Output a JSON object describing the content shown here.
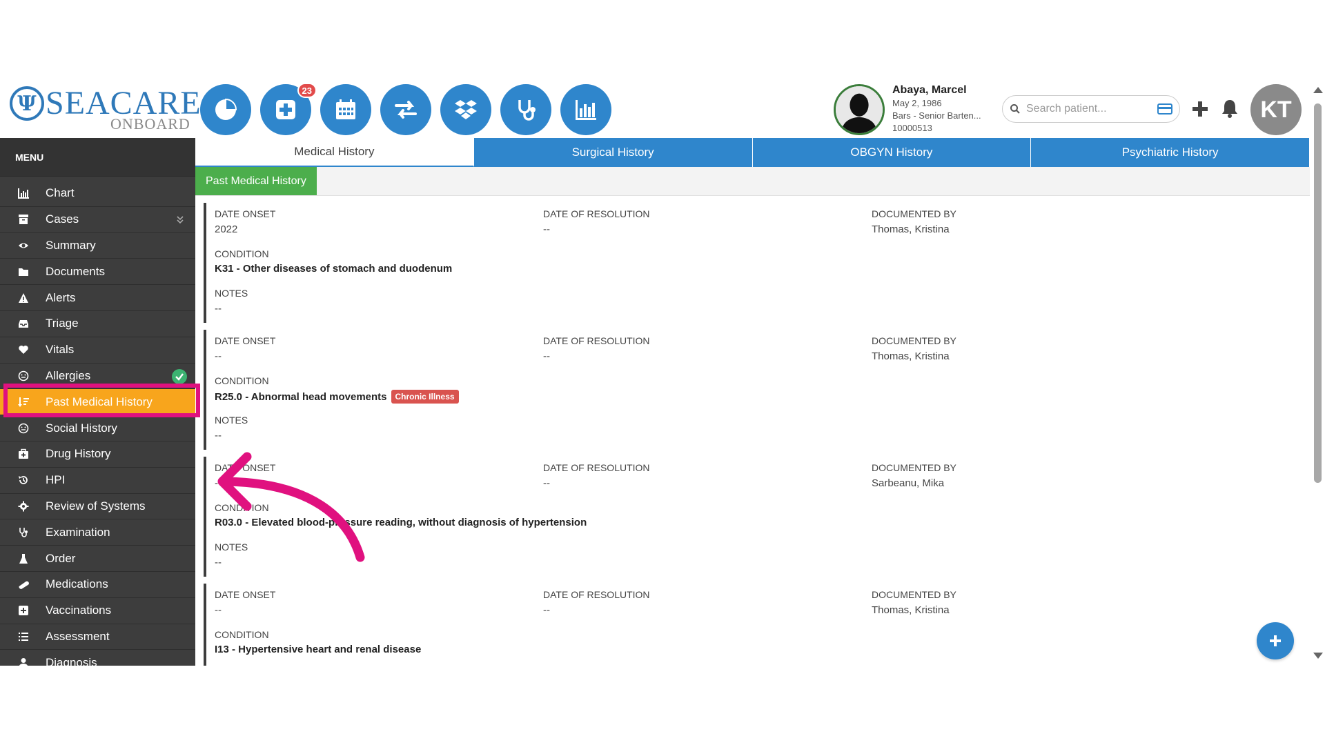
{
  "logo": {
    "name": "SEACARE",
    "sub": "ONBOARD"
  },
  "toolbar": {
    "buttons": [
      {
        "icon": "pie-chart-icon"
      },
      {
        "icon": "medical-cross-icon",
        "badge": "23"
      },
      {
        "icon": "calendar-icon"
      },
      {
        "icon": "transfer-icon"
      },
      {
        "icon": "dropbox-icon"
      },
      {
        "icon": "stethoscope-icon"
      },
      {
        "icon": "bar-chart-icon"
      }
    ]
  },
  "patient": {
    "name": "Abaya, Marcel",
    "dob": "May 2, 1986",
    "role": "Bars - Senior Barten...",
    "id": "10000513"
  },
  "search": {
    "placeholder": "Search patient..."
  },
  "user": {
    "initials": "KT"
  },
  "sidebar": {
    "title": "MENU",
    "items": [
      {
        "label": "Chart",
        "icon": "bar-chart-icon"
      },
      {
        "label": "Cases",
        "icon": "archive-icon",
        "expandable": true
      },
      {
        "label": "Summary",
        "icon": "eye-icon"
      },
      {
        "label": "Documents",
        "icon": "folder-icon"
      },
      {
        "label": "Alerts",
        "icon": "warning-icon"
      },
      {
        "label": "Triage",
        "icon": "inbox-icon"
      },
      {
        "label": "Vitals",
        "icon": "heart-icon"
      },
      {
        "label": "Allergies",
        "icon": "face-icon",
        "status": "check"
      },
      {
        "label": "Past Medical History",
        "icon": "sort-icon",
        "active": true
      },
      {
        "label": "Social History",
        "icon": "face-icon"
      },
      {
        "label": "Drug History",
        "icon": "medkit-icon"
      },
      {
        "label": "HPI",
        "icon": "history-icon"
      },
      {
        "label": "Review of Systems",
        "icon": "gear-icon"
      },
      {
        "label": "Examination",
        "icon": "stethoscope-icon"
      },
      {
        "label": "Order",
        "icon": "flask-icon"
      },
      {
        "label": "Medications",
        "icon": "pill-icon"
      },
      {
        "label": "Vaccinations",
        "icon": "plus-square-icon"
      },
      {
        "label": "Assessment",
        "icon": "list-icon"
      },
      {
        "label": "Diagnosis",
        "icon": "doctor-icon"
      }
    ]
  },
  "tabs": [
    {
      "label": "Medical History",
      "active": true
    },
    {
      "label": "Surgical History"
    },
    {
      "label": "OBGYN History"
    },
    {
      "label": "Psychiatric History"
    }
  ],
  "subtab": {
    "label": "Past Medical History"
  },
  "field_labels": {
    "date_onset": "DATE ONSET",
    "date_resolution": "DATE OF RESOLUTION",
    "documented_by": "DOCUMENTED BY",
    "condition": "CONDITION",
    "notes": "NOTES"
  },
  "records": [
    {
      "date_onset": "2022",
      "date_resolution": "--",
      "documented_by": "Thomas, Kristina",
      "condition": "K31 - Other diseases of stomach and duodenum",
      "notes": "--"
    },
    {
      "date_onset": "--",
      "date_resolution": "--",
      "documented_by": "Thomas, Kristina",
      "condition": "R25.0 - Abnormal head movements",
      "tag": "Chronic Illness",
      "notes": "--"
    },
    {
      "date_onset": "--",
      "date_resolution": "--",
      "documented_by": "Sarbeanu, Mika",
      "condition": "R03.0 - Elevated blood-pressure reading, without diagnosis of hypertension",
      "notes": "--"
    },
    {
      "date_onset": "--",
      "date_resolution": "--",
      "documented_by": "Thomas, Kristina",
      "condition": "I13 - Hypertensive heart and renal disease",
      "notes": "--"
    }
  ],
  "colors": {
    "primary": "#2f86cc",
    "sidebar": "#3d3d3d",
    "active": "#f8a51c",
    "subtab": "#4cae4c",
    "chronic": "#d9534f",
    "annotation": "#e0117f"
  }
}
